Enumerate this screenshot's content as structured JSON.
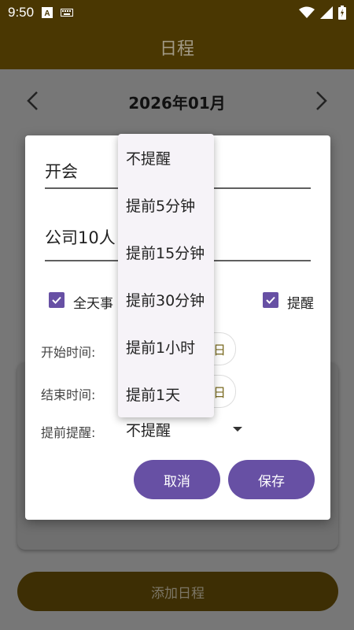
{
  "status_bar": {
    "time": "9:50",
    "icons": [
      "a-notification-icon",
      "keyboard-icon",
      "wifi-icon",
      "signal-icon",
      "battery-icon"
    ]
  },
  "app_bar": {
    "title": "日程"
  },
  "calendar": {
    "month": "2026年01月"
  },
  "add_button": {
    "label": "添加日程"
  },
  "dialog": {
    "title_field": {
      "value": "开会"
    },
    "description_field": {
      "value": "公司10人"
    },
    "all_day": {
      "label": "全天事",
      "checked": true
    },
    "remind": {
      "label": "提醒",
      "checked": true
    },
    "start_time": {
      "label": "开始时间:",
      "button_suffix": "日"
    },
    "end_time": {
      "label": "结束时间:",
      "button_suffix": "日"
    },
    "advance_reminder": {
      "label": "提前提醒:",
      "selected": "不提醒"
    },
    "cancel_label": "取消",
    "save_label": "保存"
  },
  "reminder_menu": {
    "options": [
      "不提醒",
      "提前5分钟",
      "提前15分钟",
      "提前30分钟",
      "提前1小时",
      "提前1天"
    ]
  },
  "colors": {
    "app_bar": "#4a3702",
    "accent": "#6750a4",
    "scrim_bg": "#777777"
  }
}
